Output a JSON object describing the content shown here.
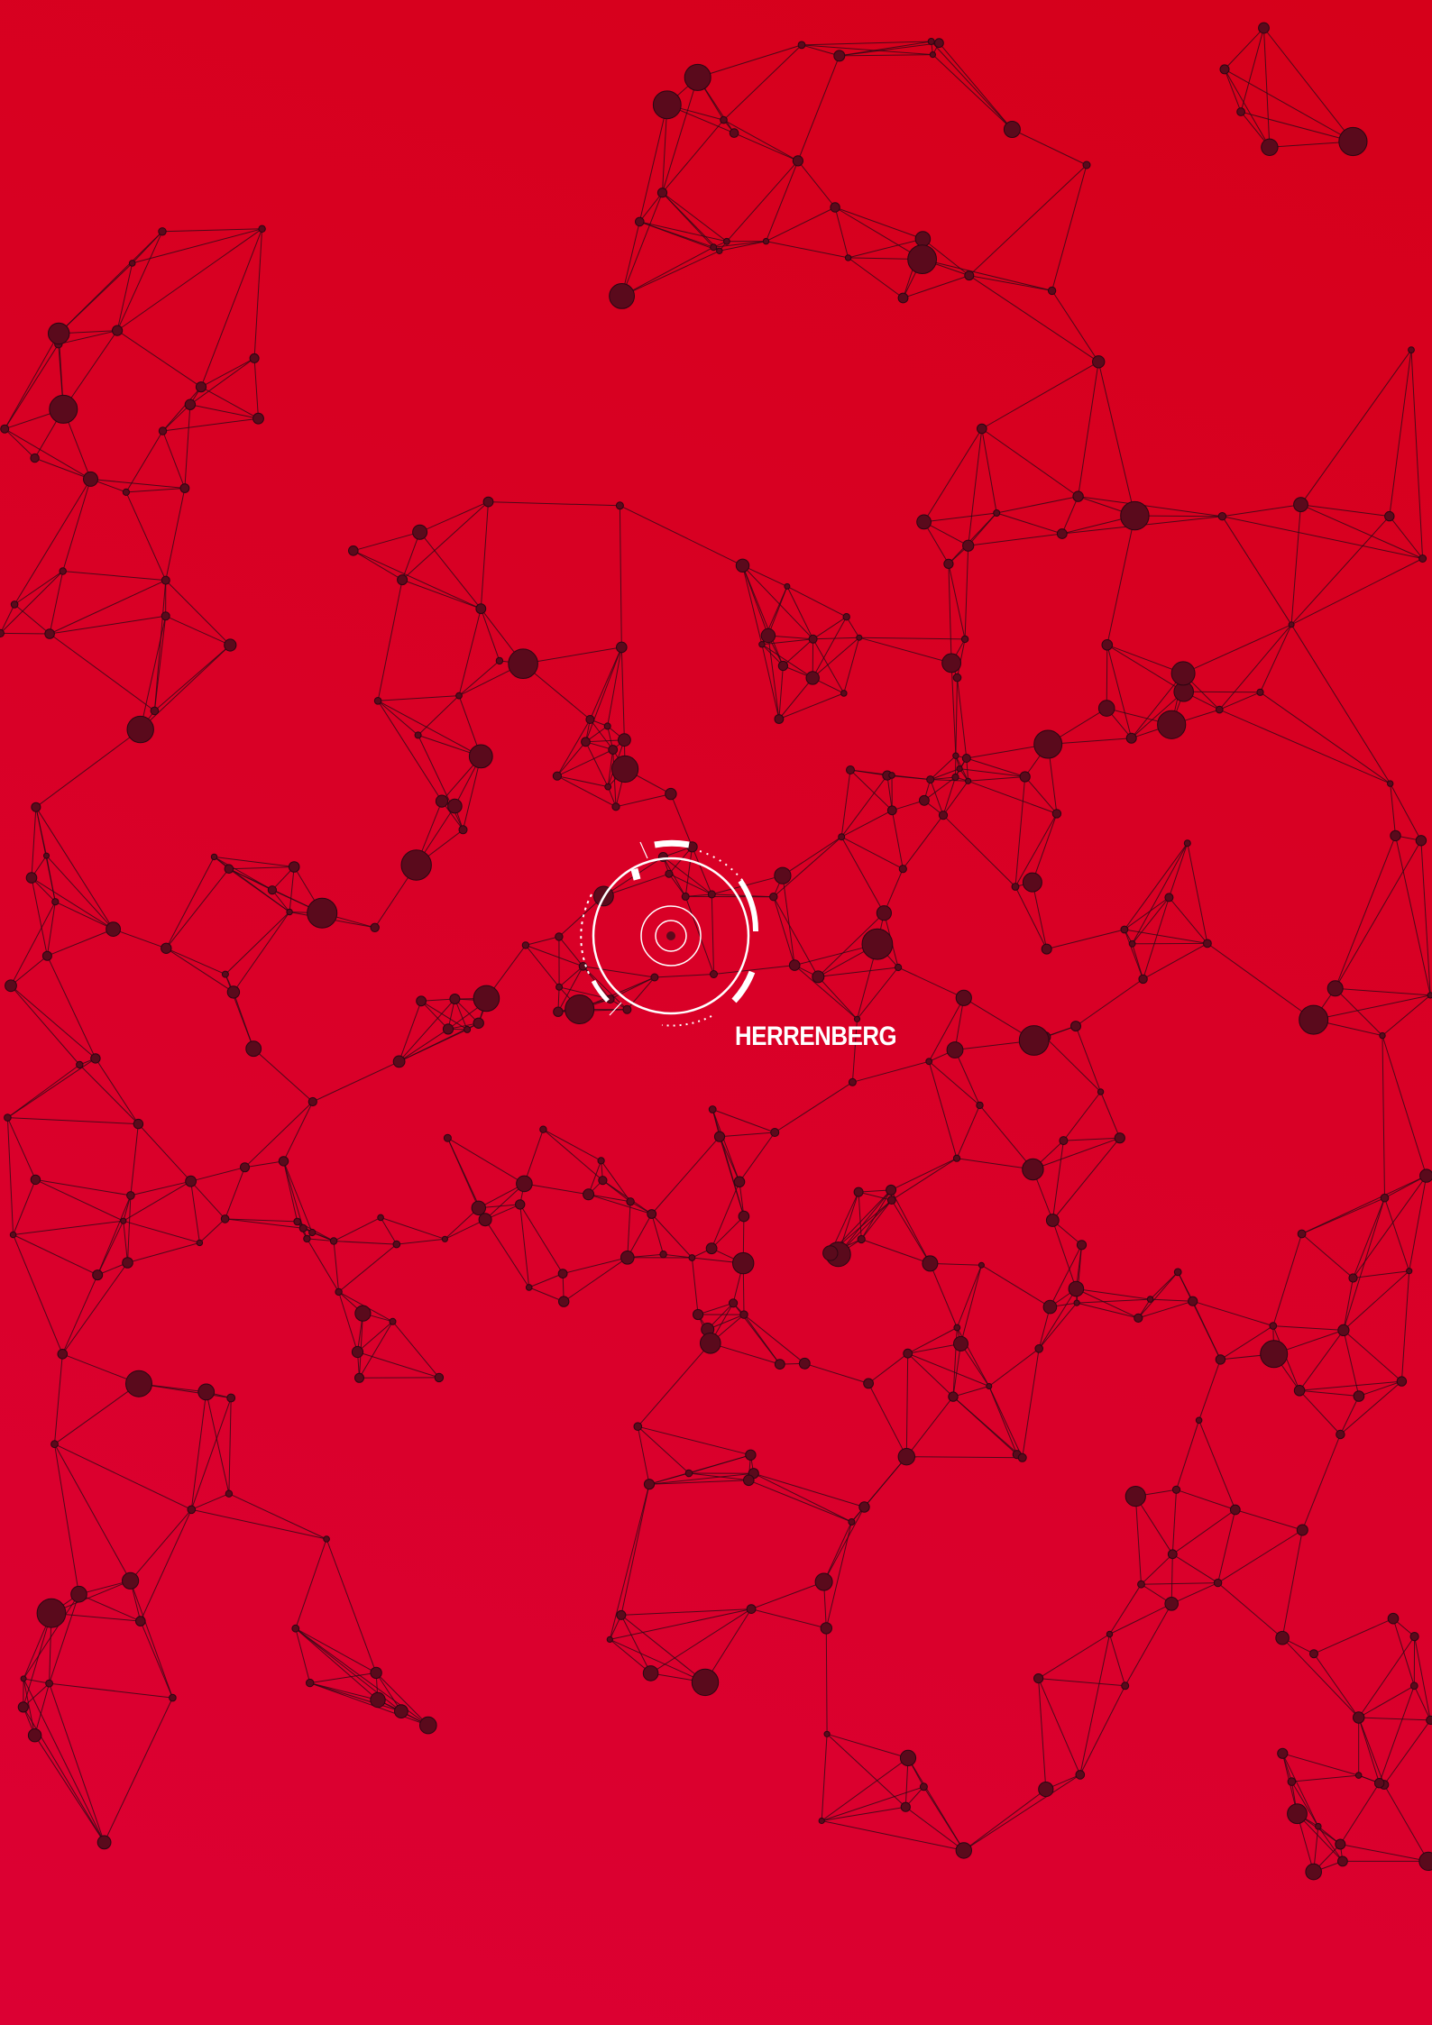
{
  "map": {
    "location_label": "HERRENBERG",
    "colors": {
      "background": "#d9001f",
      "network_lines": "#2a0b16",
      "network_nodes": "#5a0a1c",
      "marker": "#ffffff"
    },
    "icons": {
      "location_marker": "target-reticle-icon"
    }
  }
}
